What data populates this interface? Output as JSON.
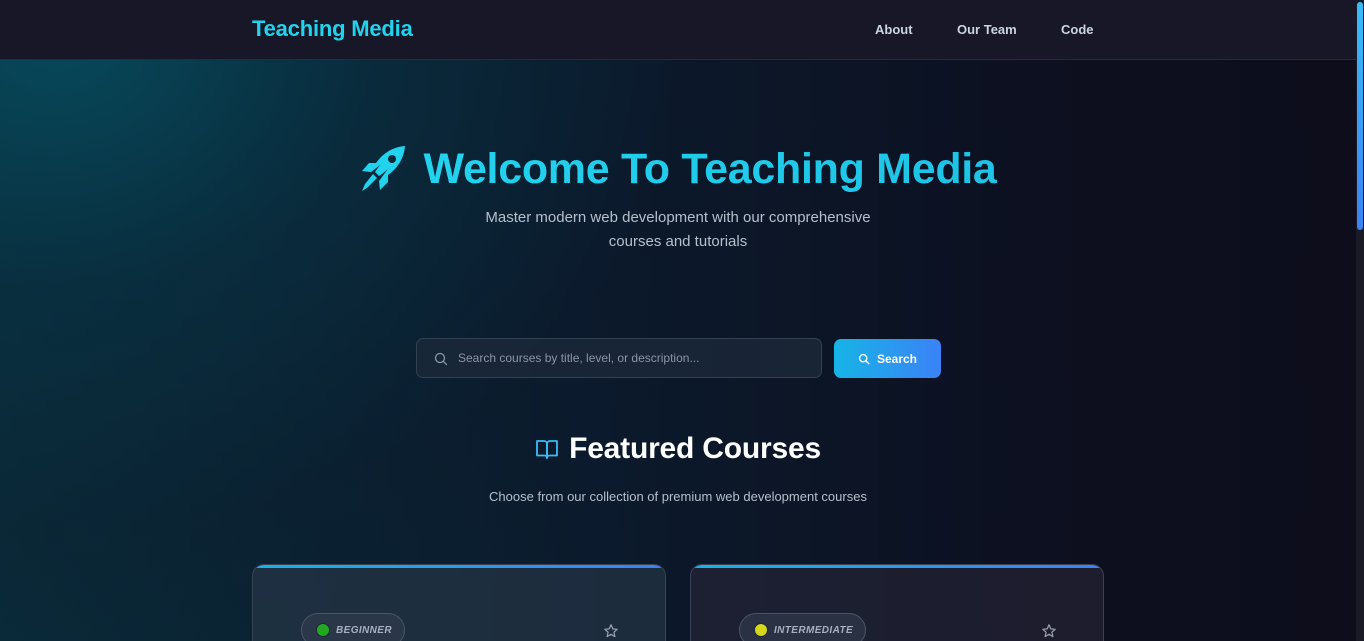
{
  "nav": {
    "brand": "Teaching Media",
    "links": [
      {
        "label": "About"
      },
      {
        "label": "Our Team"
      },
      {
        "label": "Code"
      }
    ]
  },
  "hero": {
    "icon": "rocket-icon",
    "title": "Welcome To Teaching Media",
    "subtitle": "Master modern web development with our comprehensive courses and tutorials"
  },
  "search": {
    "placeholder": "Search courses by title, level, or description...",
    "value": "",
    "button_label": "Search"
  },
  "featured": {
    "icon": "book-open-icon",
    "title": "Featured Courses",
    "subtitle": "Choose from our collection of premium web development courses"
  },
  "courses": [
    {
      "level": "BEGINNER",
      "level_color": "#22a822",
      "favorite_icon": "star-outline-icon"
    },
    {
      "level": "INTERMEDIATE",
      "level_color": "#d6d61a",
      "favorite_icon": "star-outline-icon"
    }
  ],
  "colors": {
    "accent": "#22d3ee",
    "button_gradient_start": "#16b4e6",
    "button_gradient_end": "#3b82f6",
    "background": "#0d0d1c"
  }
}
